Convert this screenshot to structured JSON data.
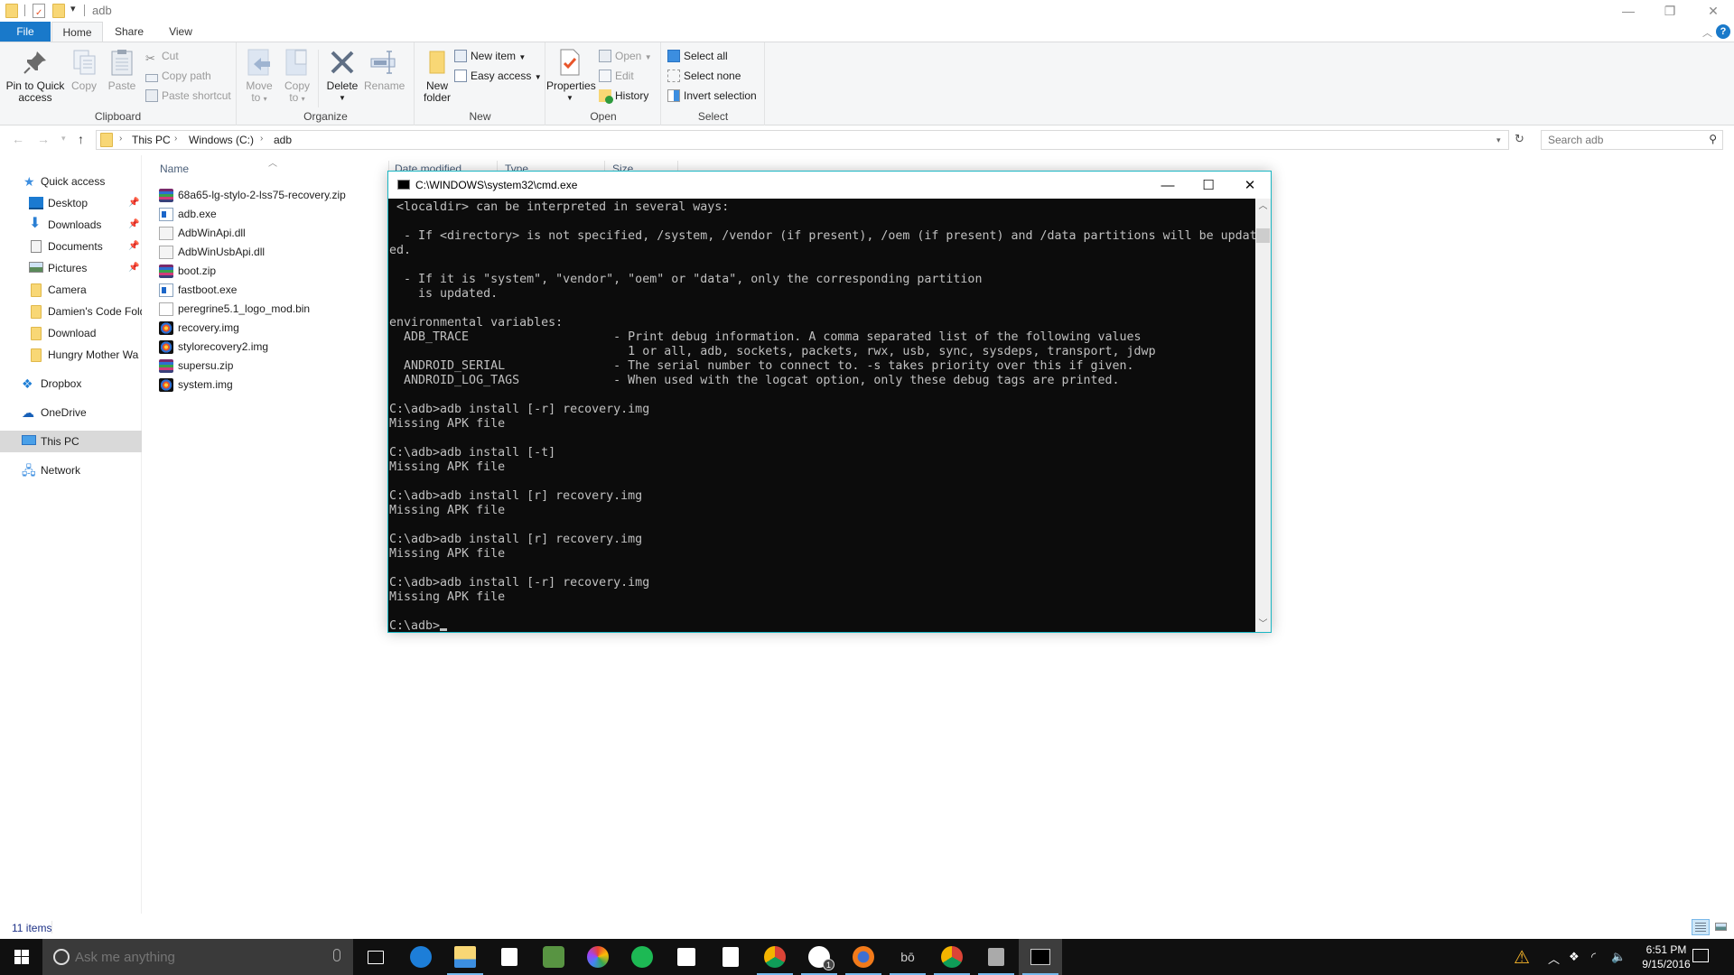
{
  "explorer": {
    "window_title": "adb",
    "ribbon_tabs": [
      "File",
      "Home",
      "Share",
      "View"
    ],
    "ribbon": {
      "clipboard": {
        "label": "Clipboard",
        "pin_to_quick_access": "Pin to Quick access",
        "pin_line1": "Pin to Quick",
        "pin_line2": "access",
        "copy": "Copy",
        "paste": "Paste",
        "cut": "Cut",
        "copy_path": "Copy path",
        "paste_shortcut": "Paste shortcut"
      },
      "organize": {
        "label": "Organize",
        "move_to_1": "Move",
        "move_to_2": "to",
        "copy_to_1": "Copy",
        "copy_to_2": "to",
        "delete": "Delete",
        "rename": "Rename"
      },
      "new": {
        "label": "New",
        "new_folder_1": "New",
        "new_folder_2": "folder",
        "new_item": "New item",
        "easy_access": "Easy access"
      },
      "open": {
        "label": "Open",
        "properties": "Properties",
        "open": "Open",
        "edit": "Edit",
        "history": "History"
      },
      "select": {
        "label": "Select",
        "select_all": "Select all",
        "select_none": "Select none",
        "invert_selection": "Invert selection"
      }
    },
    "address": {
      "breadcrumbs": [
        "This PC",
        "Windows (C:)",
        "adb"
      ]
    },
    "search": {
      "placeholder": "Search adb"
    },
    "nav_pane": {
      "quick_access": "Quick access",
      "pinned": [
        "Desktop",
        "Downloads",
        "Documents",
        "Pictures"
      ],
      "folders": [
        "Camera",
        "Damien's Code Folder",
        "Download",
        "Hungry Mother Wa"
      ],
      "roots": [
        "Dropbox",
        "OneDrive",
        "This PC",
        "Network"
      ],
      "selected": "This PC"
    },
    "columns": [
      "Name",
      "Date modified",
      "Type",
      "Size"
    ],
    "files": [
      {
        "name": "68a65-lg-stylo-2-lss75-recovery.zip",
        "icon": "zip"
      },
      {
        "name": "adb.exe",
        "icon": "exe"
      },
      {
        "name": "AdbWinApi.dll",
        "icon": "dll"
      },
      {
        "name": "AdbWinUsbApi.dll",
        "icon": "dll"
      },
      {
        "name": "boot.zip",
        "icon": "zip"
      },
      {
        "name": "fastboot.exe",
        "icon": "exe"
      },
      {
        "name": "peregrine5.1_logo_mod.bin",
        "icon": "bin"
      },
      {
        "name": "recovery.img",
        "icon": "img"
      },
      {
        "name": "stylorecovery2.img",
        "icon": "img"
      },
      {
        "name": "supersu.zip",
        "icon": "zip"
      },
      {
        "name": "system.img",
        "icon": "img"
      }
    ],
    "status": {
      "item_count": "11 items"
    }
  },
  "cmd": {
    "title": "C:\\WINDOWS\\system32\\cmd.exe",
    "lines": [
      " <localdir> can be interpreted in several ways:",
      "",
      "  - If <directory> is not specified, /system, /vendor (if present), /oem (if present) and /data partitions will be updat",
      "ed.",
      "",
      "  - If it is \"system\", \"vendor\", \"oem\" or \"data\", only the corresponding partition",
      "    is updated.",
      "",
      "environmental variables:",
      "  ADB_TRACE                    - Print debug information. A comma separated list of the following values",
      "                                 1 or all, adb, sockets, packets, rwx, usb, sync, sysdeps, transport, jdwp",
      "  ANDROID_SERIAL               - The serial number to connect to. -s takes priority over this if given.",
      "  ANDROID_LOG_TAGS             - When used with the logcat option, only these debug tags are printed.",
      "",
      "C:\\adb>adb install [-r] recovery.img",
      "Missing APK file",
      "",
      "C:\\adb>adb install [-t]",
      "Missing APK file",
      "",
      "C:\\adb>adb install [r] recovery.img",
      "Missing APK file",
      "",
      "C:\\adb>adb install [r] recovery.img",
      "Missing APK file",
      "",
      "C:\\adb>adb install [-r] recovery.img",
      "Missing APK file",
      ""
    ],
    "prompt": "C:\\adb>"
  },
  "taskbar": {
    "search_placeholder": "Ask me anything",
    "apps": [
      "Task View",
      "Microsoft Edge",
      "File Explorer",
      "Store",
      "TripAdvisor",
      "Photos",
      "Spotify",
      "Calendar",
      "Calculator",
      "Google Chrome",
      "Xbox",
      "Firefox",
      "Beats Audio",
      "Google Chrome",
      "Device",
      "Command Prompt"
    ],
    "xbox_badge": "1",
    "clock_time": "6:51 PM",
    "clock_date": "9/15/2016"
  },
  "colors": {
    "accent": "#1979ca",
    "cmd_border": "#19b6c3",
    "taskbar_running": "#76b9ed"
  }
}
